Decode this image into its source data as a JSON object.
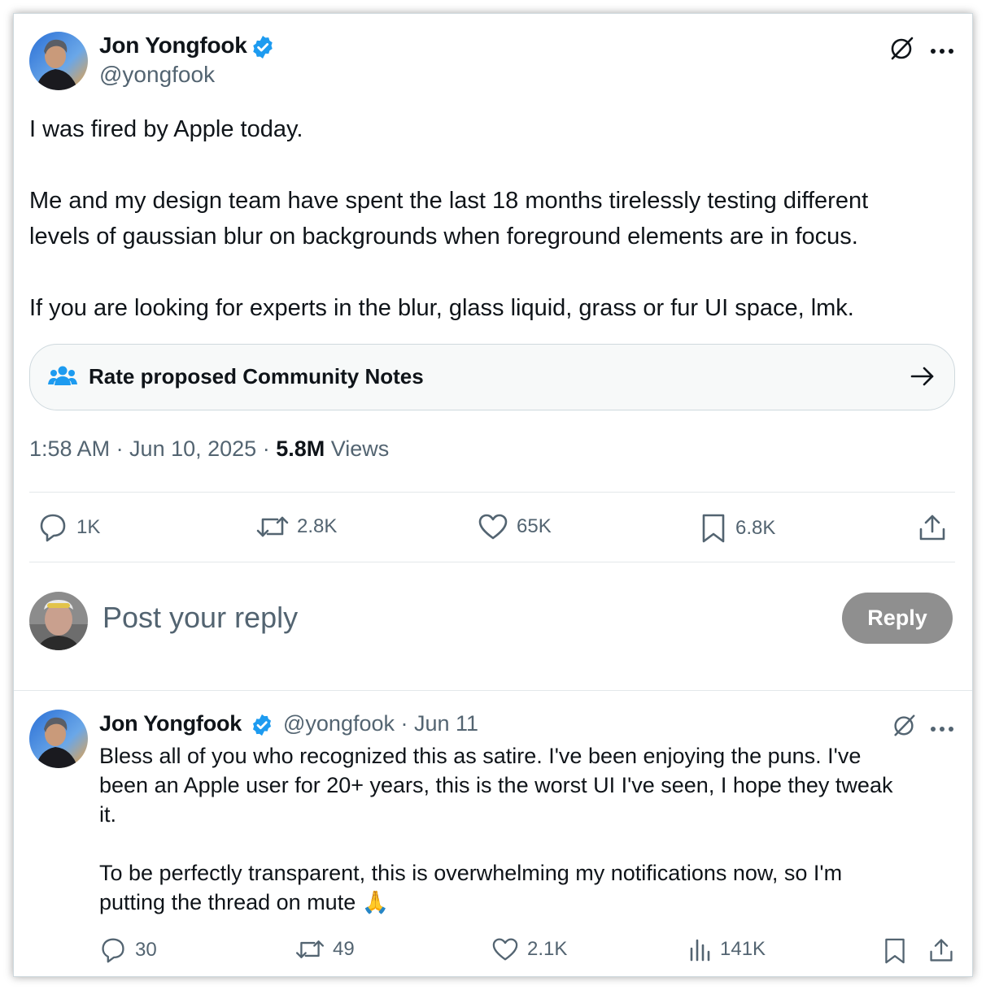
{
  "main_tweet": {
    "author": {
      "name": "Jon Yongfook",
      "handle": "@yongfook",
      "verified": true
    },
    "text_lines": [
      "I was fired by Apple today.",
      "Me and my design team have spent the last 18 months tirelessly testing different",
      "levels of gaussian blur on backgrounds when foreground elements are in focus.",
      "If you are looking for experts in the blur, glass liquid, grass or fur UI space, lmk."
    ],
    "community_notes_label": "Rate proposed Community Notes",
    "timestamp": "1:58 AM · Jun 10, 2025 · ",
    "views_count": "5.8M",
    "views_label": " Views",
    "actions": {
      "replies": "1K",
      "reposts": "2.8K",
      "likes": "65K",
      "bookmarks": "6.8K"
    }
  },
  "composer": {
    "placeholder": "Post your reply",
    "reply_button": "Reply"
  },
  "reply_tweet": {
    "author": {
      "name": "Jon Yongfook",
      "handle": "@yongfook",
      "date": " · Jun 11",
      "verified": true
    },
    "text_lines": [
      "Bless all of you who recognized this as satire. I've been enjoying the puns. I've",
      "been an Apple user for 20+ years, this is the worst UI I've seen, I hope they tweak",
      "it.",
      "To be perfectly transparent, this is overwhelming my notifications now, so I'm",
      "putting the thread on mute"
    ],
    "emoji": "🙏",
    "actions": {
      "replies": "30",
      "reposts": "49",
      "likes": "2.1K",
      "views": "141K"
    }
  },
  "colors": {
    "text_primary": "#0f1419",
    "text_secondary": "#536471",
    "verified_blue": "#1d9bf0",
    "reply_button_bg": "#8f8f8f",
    "border": "#cfd9de"
  },
  "icons": {
    "grok": "grok-icon",
    "more": "more-icon",
    "people": "people-icon",
    "arrow": "arrow-right-icon",
    "reply": "reply-icon",
    "repost": "repost-icon",
    "like": "like-icon",
    "bookmark": "bookmark-icon",
    "share": "share-icon",
    "views": "views-icon"
  }
}
